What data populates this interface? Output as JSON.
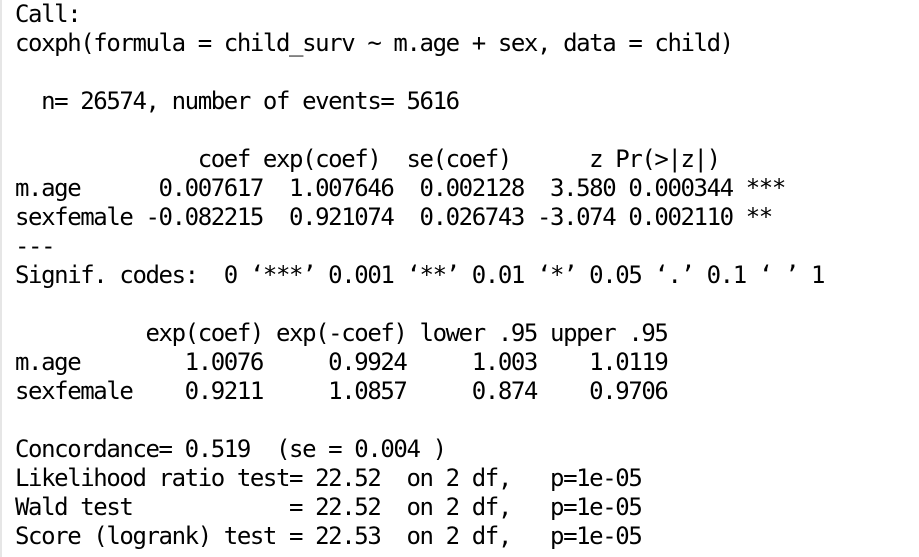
{
  "console": {
    "lines": [
      "Call:",
      "coxph(formula = child_surv ~ m.age + sex, data = child)",
      "",
      "  n= 26574, number of events= 5616",
      "",
      "              coef exp(coef)  se(coef)      z Pr(>|z|)    ",
      "m.age      0.007617  1.007646  0.002128  3.580 0.000344 ***",
      "sexfemale -0.082215  0.921074  0.026743 -3.074 0.002110 ** ",
      "---",
      "Signif. codes:  0 ‘***’ 0.001 ‘**’ 0.01 ‘*’ 0.05 ‘.’ 0.1 ‘ ’ 1",
      "",
      "          exp(coef) exp(-coef) lower .95 upper .95",
      "m.age        1.0076     0.9924     1.003    1.0119",
      "sexfemale    0.9211     1.0857     0.874    0.9706",
      "",
      "Concordance= 0.519  (se = 0.004 )",
      "Likelihood ratio test= 22.52  on 2 df,   p=1e-05",
      "Wald test            = 22.52  on 2 df,   p=1e-05",
      "Score (logrank) test = 22.53  on 2 df,   p=1e-05"
    ]
  }
}
